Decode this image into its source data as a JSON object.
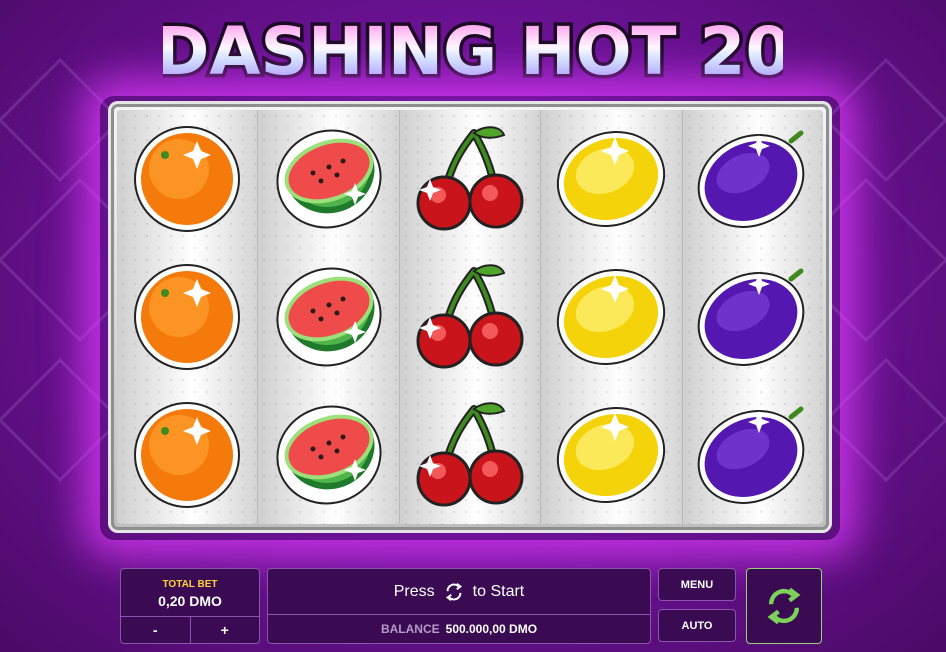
{
  "game": {
    "title": "DASHING HOT 20"
  },
  "reels": [
    [
      "orange-icon",
      "orange-icon",
      "orange-icon"
    ],
    [
      "watermelon-icon",
      "watermelon-icon",
      "watermelon-icon"
    ],
    [
      "cherry-icon",
      "cherry-icon",
      "cherry-icon"
    ],
    [
      "lemon-icon",
      "lemon-icon",
      "lemon-icon"
    ],
    [
      "plum-icon",
      "plum-icon",
      "plum-icon"
    ]
  ],
  "total_bet": {
    "label": "TOTAL BET",
    "value": "0,20 DMO",
    "minus": "-",
    "plus": "+"
  },
  "start": {
    "press": "Press",
    "to_start": "to Start"
  },
  "balance": {
    "label": "BALANCE",
    "value": "500.000,00 DMO"
  },
  "buttons": {
    "menu": "MENU",
    "auto": "AUTO"
  },
  "colors": {
    "background": "#6f139a",
    "accent_yellow": "#ffd43a",
    "spin_green": "#7dd35a"
  }
}
